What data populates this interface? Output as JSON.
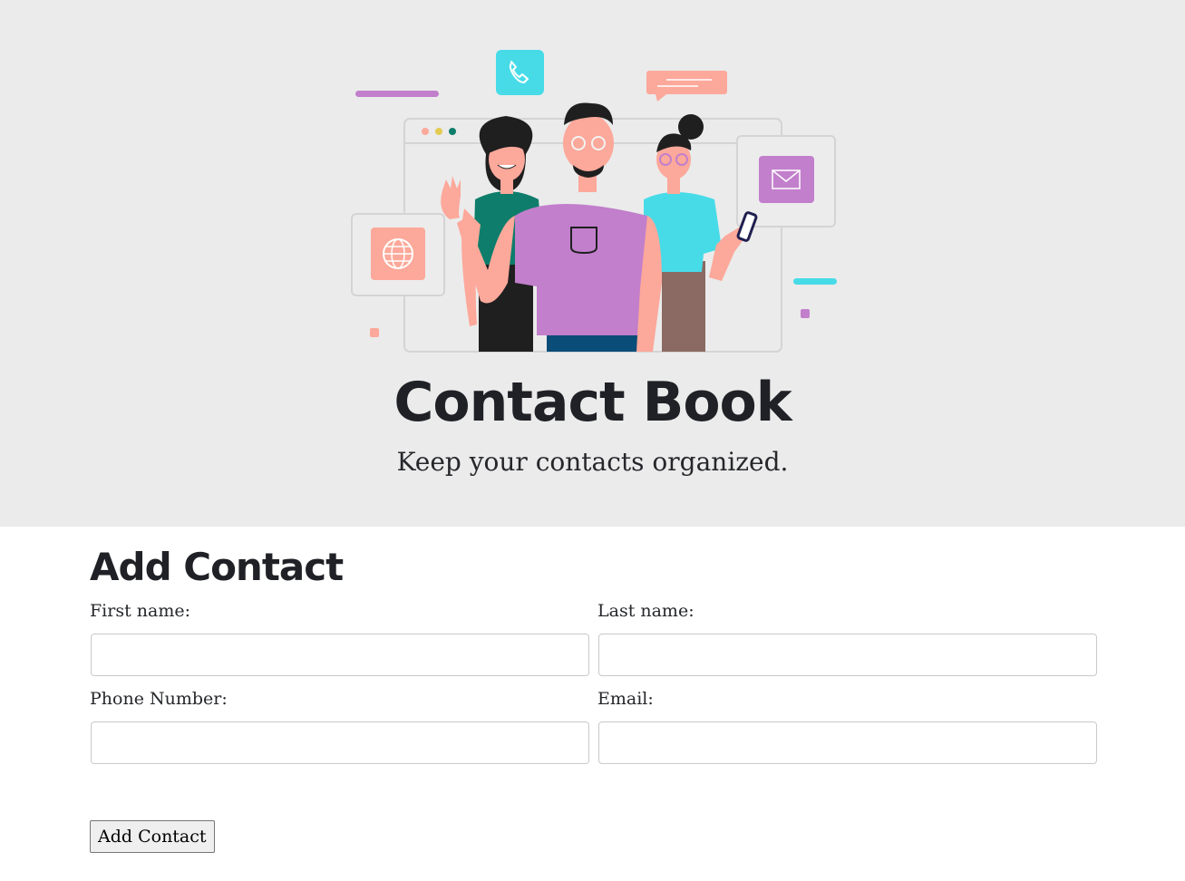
{
  "header": {
    "title": "Contact Book",
    "subtitle": "Keep your contacts organized."
  },
  "illustration": {
    "icons": [
      "phone-icon",
      "chat-bubble-icon",
      "envelope-icon",
      "globe-icon"
    ],
    "colors": {
      "background": "#ebebeb",
      "purple": "#c27fcc",
      "cyan": "#47dbe8",
      "salmon": "#fca89a",
      "teal": "#0e7d6b"
    }
  },
  "form": {
    "title": "Add Contact",
    "fields": [
      {
        "label": "First name:",
        "value": ""
      },
      {
        "label": "Last name:",
        "value": ""
      },
      {
        "label": "Phone Number:",
        "value": ""
      },
      {
        "label": "Email:",
        "value": ""
      }
    ],
    "submit_label": "Add Contact"
  }
}
